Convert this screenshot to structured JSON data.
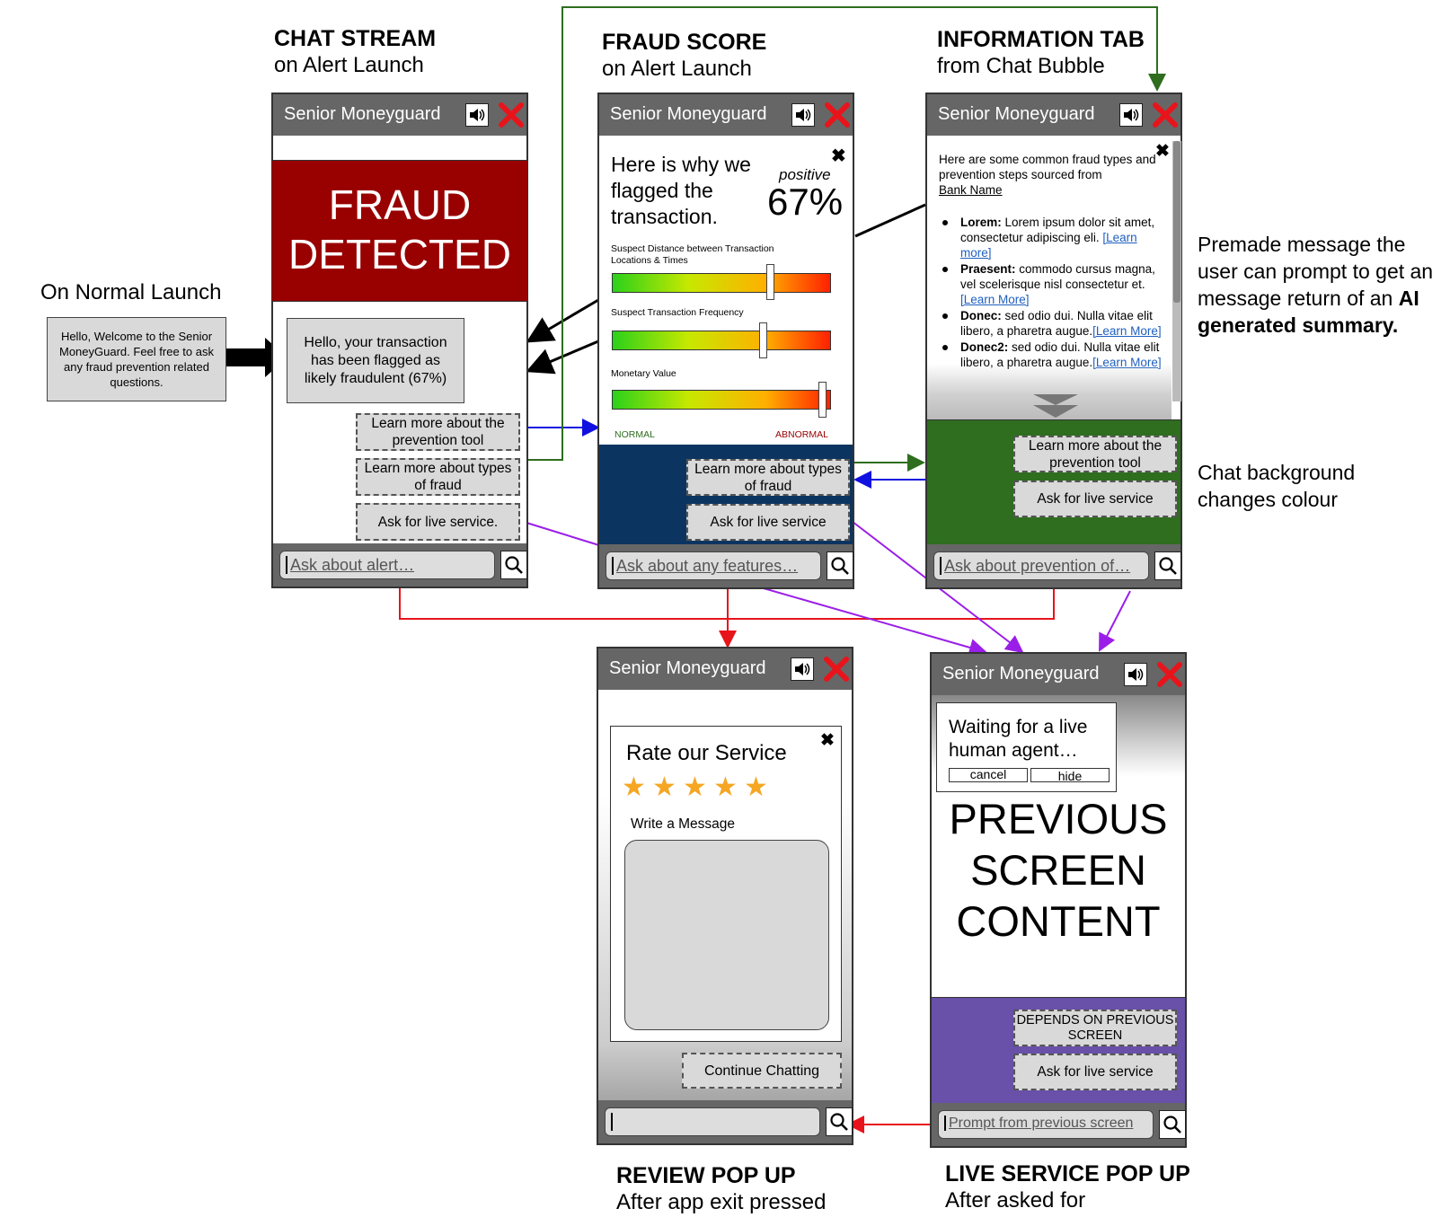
{
  "captions": {
    "chat_stream": {
      "title": "CHAT STREAM",
      "sub": "on Alert Launch"
    },
    "fraud_score": {
      "title": "FRAUD SCORE",
      "sub": "on Alert Launch"
    },
    "info_tab": {
      "title": "INFORMATION TAB",
      "sub": "from Chat Bubble"
    },
    "review": {
      "title": "REVIEW POP UP",
      "sub": "After app exit pressed"
    },
    "live": {
      "title": "LIVE SERVICE POP UP",
      "sub": "After asked for"
    }
  },
  "app_title": "Senior Moneyguard",
  "normal_launch": {
    "label": "On Normal Launch",
    "message": "Hello, Welcome to the Senior MoneyGuard. Feel free to ask any fraud prevention related questions."
  },
  "side_notes": {
    "premade_a": "Premade message the user can prompt to get an message return of an",
    "premade_b": "AI generated summary.",
    "bg_change": "Chat background changes colour"
  },
  "chat_stream": {
    "banner": "FRAUD DETECTED",
    "bubble": "Hello, your transaction has been flagged as likely fraudulent (67%)",
    "btn_tool": "Learn more about the prevention tool",
    "btn_types": "Learn more about types of fraud",
    "btn_live": "Ask for live service.",
    "input": "Ask about alert…"
  },
  "fraud_score": {
    "heading": "Here is why we flagged the transaction.",
    "positive": "positive",
    "percent": "67%",
    "bar1": "Suspect Distance between Transaction Locations & Times",
    "bar2": "Suspect Transaction Frequency",
    "bar3": "Monetary Value",
    "bar1_level": 0.72,
    "bar2_level": 0.69,
    "bar3_level": 0.96,
    "normal": "NORMAL",
    "abnormal": "ABNORMAL",
    "btn_types": "Learn more about types of fraud",
    "btn_live": "Ask for live service",
    "input": "Ask about any features…"
  },
  "info_tab": {
    "intro": "Here are some common fraud types and prevention steps sourced from",
    "bank": "Bank Name",
    "items": [
      {
        "term": "Lorem:",
        "text": " Lorem ipsum dolor sit amet, consectetur adipiscing eli. ",
        "link": "[Learn more]"
      },
      {
        "term": "Praesent:",
        "text": " commodo cursus magna, vel scelerisque nisl consectetur et.",
        "link": "[Learn More]"
      },
      {
        "term": "Donec:",
        "text": " sed odio dui. Nulla vitae elit libero, a pharetra augue.",
        "link": "[Learn More]"
      },
      {
        "term": "Donec2:",
        "text": " sed odio dui. Nulla vitae elit libero, a pharetra augue.",
        "link": "[Learn More]"
      }
    ],
    "btn_tool": "Learn more about the prevention tool",
    "btn_live": "Ask for live service",
    "input": "Ask about prevention of…"
  },
  "review": {
    "title": "Rate our Service",
    "stars": 5,
    "write": "Write a Message",
    "continue": "Continue Chatting"
  },
  "live": {
    "waiting": "Waiting for a live human agent…",
    "cancel": "cancel",
    "hide": "hide",
    "content": "PREVIOUS SCREEN CONTENT",
    "btn_depends": "DEPENDS ON PREVIOUS SCREEN",
    "btn_live": "Ask for live service",
    "input": "Prompt from previous screen"
  },
  "colors": {
    "header": "#666666",
    "fraud_banner": "#990000",
    "fraud_score_bg": "#0b3560",
    "info_bg": "#2e6e1e",
    "live_bg": "#6950a8",
    "close_x": "#e8141b"
  }
}
